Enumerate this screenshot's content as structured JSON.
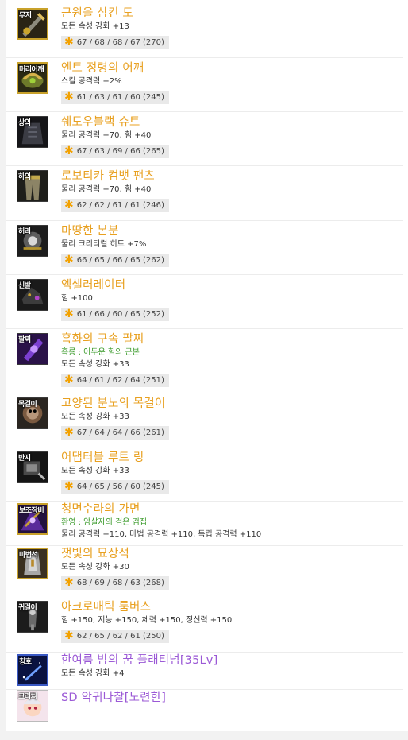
{
  "items": [
    {
      "slot": "무지",
      "name": "근원을 삼킨 도",
      "lines": [
        {
          "text": "모든 속성 강화 +13"
        }
      ],
      "stats": "67 / 68 / 68 / 67 (270)"
    },
    {
      "slot": "머리어깨",
      "name": "엔트 정령의 어깨",
      "lines": [
        {
          "text": "스킬 공격력 +2%"
        }
      ],
      "stats": "61 / 63 / 61 / 60 (245)"
    },
    {
      "slot": "상의",
      "name": "쉐도우블랙 슈트",
      "lines": [
        {
          "text": "물리 공격력 +70, 힘 +40"
        }
      ],
      "stats": "67 / 63 / 69 / 66 (265)"
    },
    {
      "slot": "하의",
      "name": "로보티카 컴뱃 팬츠",
      "lines": [
        {
          "text": "물리 공격력 +70, 힘 +40"
        }
      ],
      "stats": "62 / 62 / 61 / 61 (246)"
    },
    {
      "slot": "허리",
      "name": "마땅한 본분",
      "lines": [
        {
          "text": "물리 크리티컬 히트 +7%"
        }
      ],
      "stats": "66 / 65 / 66 / 65 (262)"
    },
    {
      "slot": "신발",
      "name": "엑셀러레이터",
      "lines": [
        {
          "text": "힘 +100"
        }
      ],
      "stats": "61 / 66 / 60 / 65 (252)"
    },
    {
      "slot": "팔찌",
      "name": "흑화의 구속 팔찌",
      "lines": [
        {
          "text": "흑룡 : 어두운 힘의 근본",
          "green": true
        },
        {
          "text": "모든 속성 강화 +33"
        }
      ],
      "stats": "64 / 61 / 62 / 64 (251)"
    },
    {
      "slot": "목걸이",
      "name": "고양된 분노의 목걸이",
      "lines": [
        {
          "text": "모든 속성 강화 +33"
        }
      ],
      "stats": "67 / 64 / 64 / 66 (261)"
    },
    {
      "slot": "반지",
      "name": "어댑터블 루트 링",
      "lines": [
        {
          "text": "모든 속성 강화 +33"
        }
      ],
      "stats": "64 / 65 / 56 / 60 (245)"
    },
    {
      "slot": "보조장비",
      "name": "청면수라의 가면",
      "lines": [
        {
          "text": "환영 : 암살자의 검은 검집",
          "green": true
        },
        {
          "text": "물리 공격력 +110, 마법 공격력 +110, 독립 공격력 +110"
        }
      ],
      "stats": null
    },
    {
      "slot": "마법석",
      "name": "잿빛의 묘상석",
      "lines": [
        {
          "text": "모든 속성 강화 +30"
        }
      ],
      "stats": "68 / 69 / 68 / 63 (268)"
    },
    {
      "slot": "귀걸이",
      "name": "아크로매틱 룸버스",
      "lines": [
        {
          "text": "힘 +150, 지능 +150, 체력 +150, 정신력 +150"
        }
      ],
      "stats": "62 / 65 / 62 / 61 (250)"
    },
    {
      "slot": "칭호",
      "name": "한여름 밤의 꿈 플래티넘[35Lv]",
      "purple": true,
      "lines": [
        {
          "text": "모든 속성 강화 +4"
        }
      ],
      "stats": null
    },
    {
      "slot": "크리쳐",
      "name": "SD 악귀나찰[노련한]",
      "purple": true,
      "lines": [],
      "stats": null
    }
  ],
  "colors": {
    "epic_name": "#e8a020",
    "purple_name": "#9b59d6",
    "set_effect": "#3a9a2a",
    "star": "#f2a100"
  }
}
